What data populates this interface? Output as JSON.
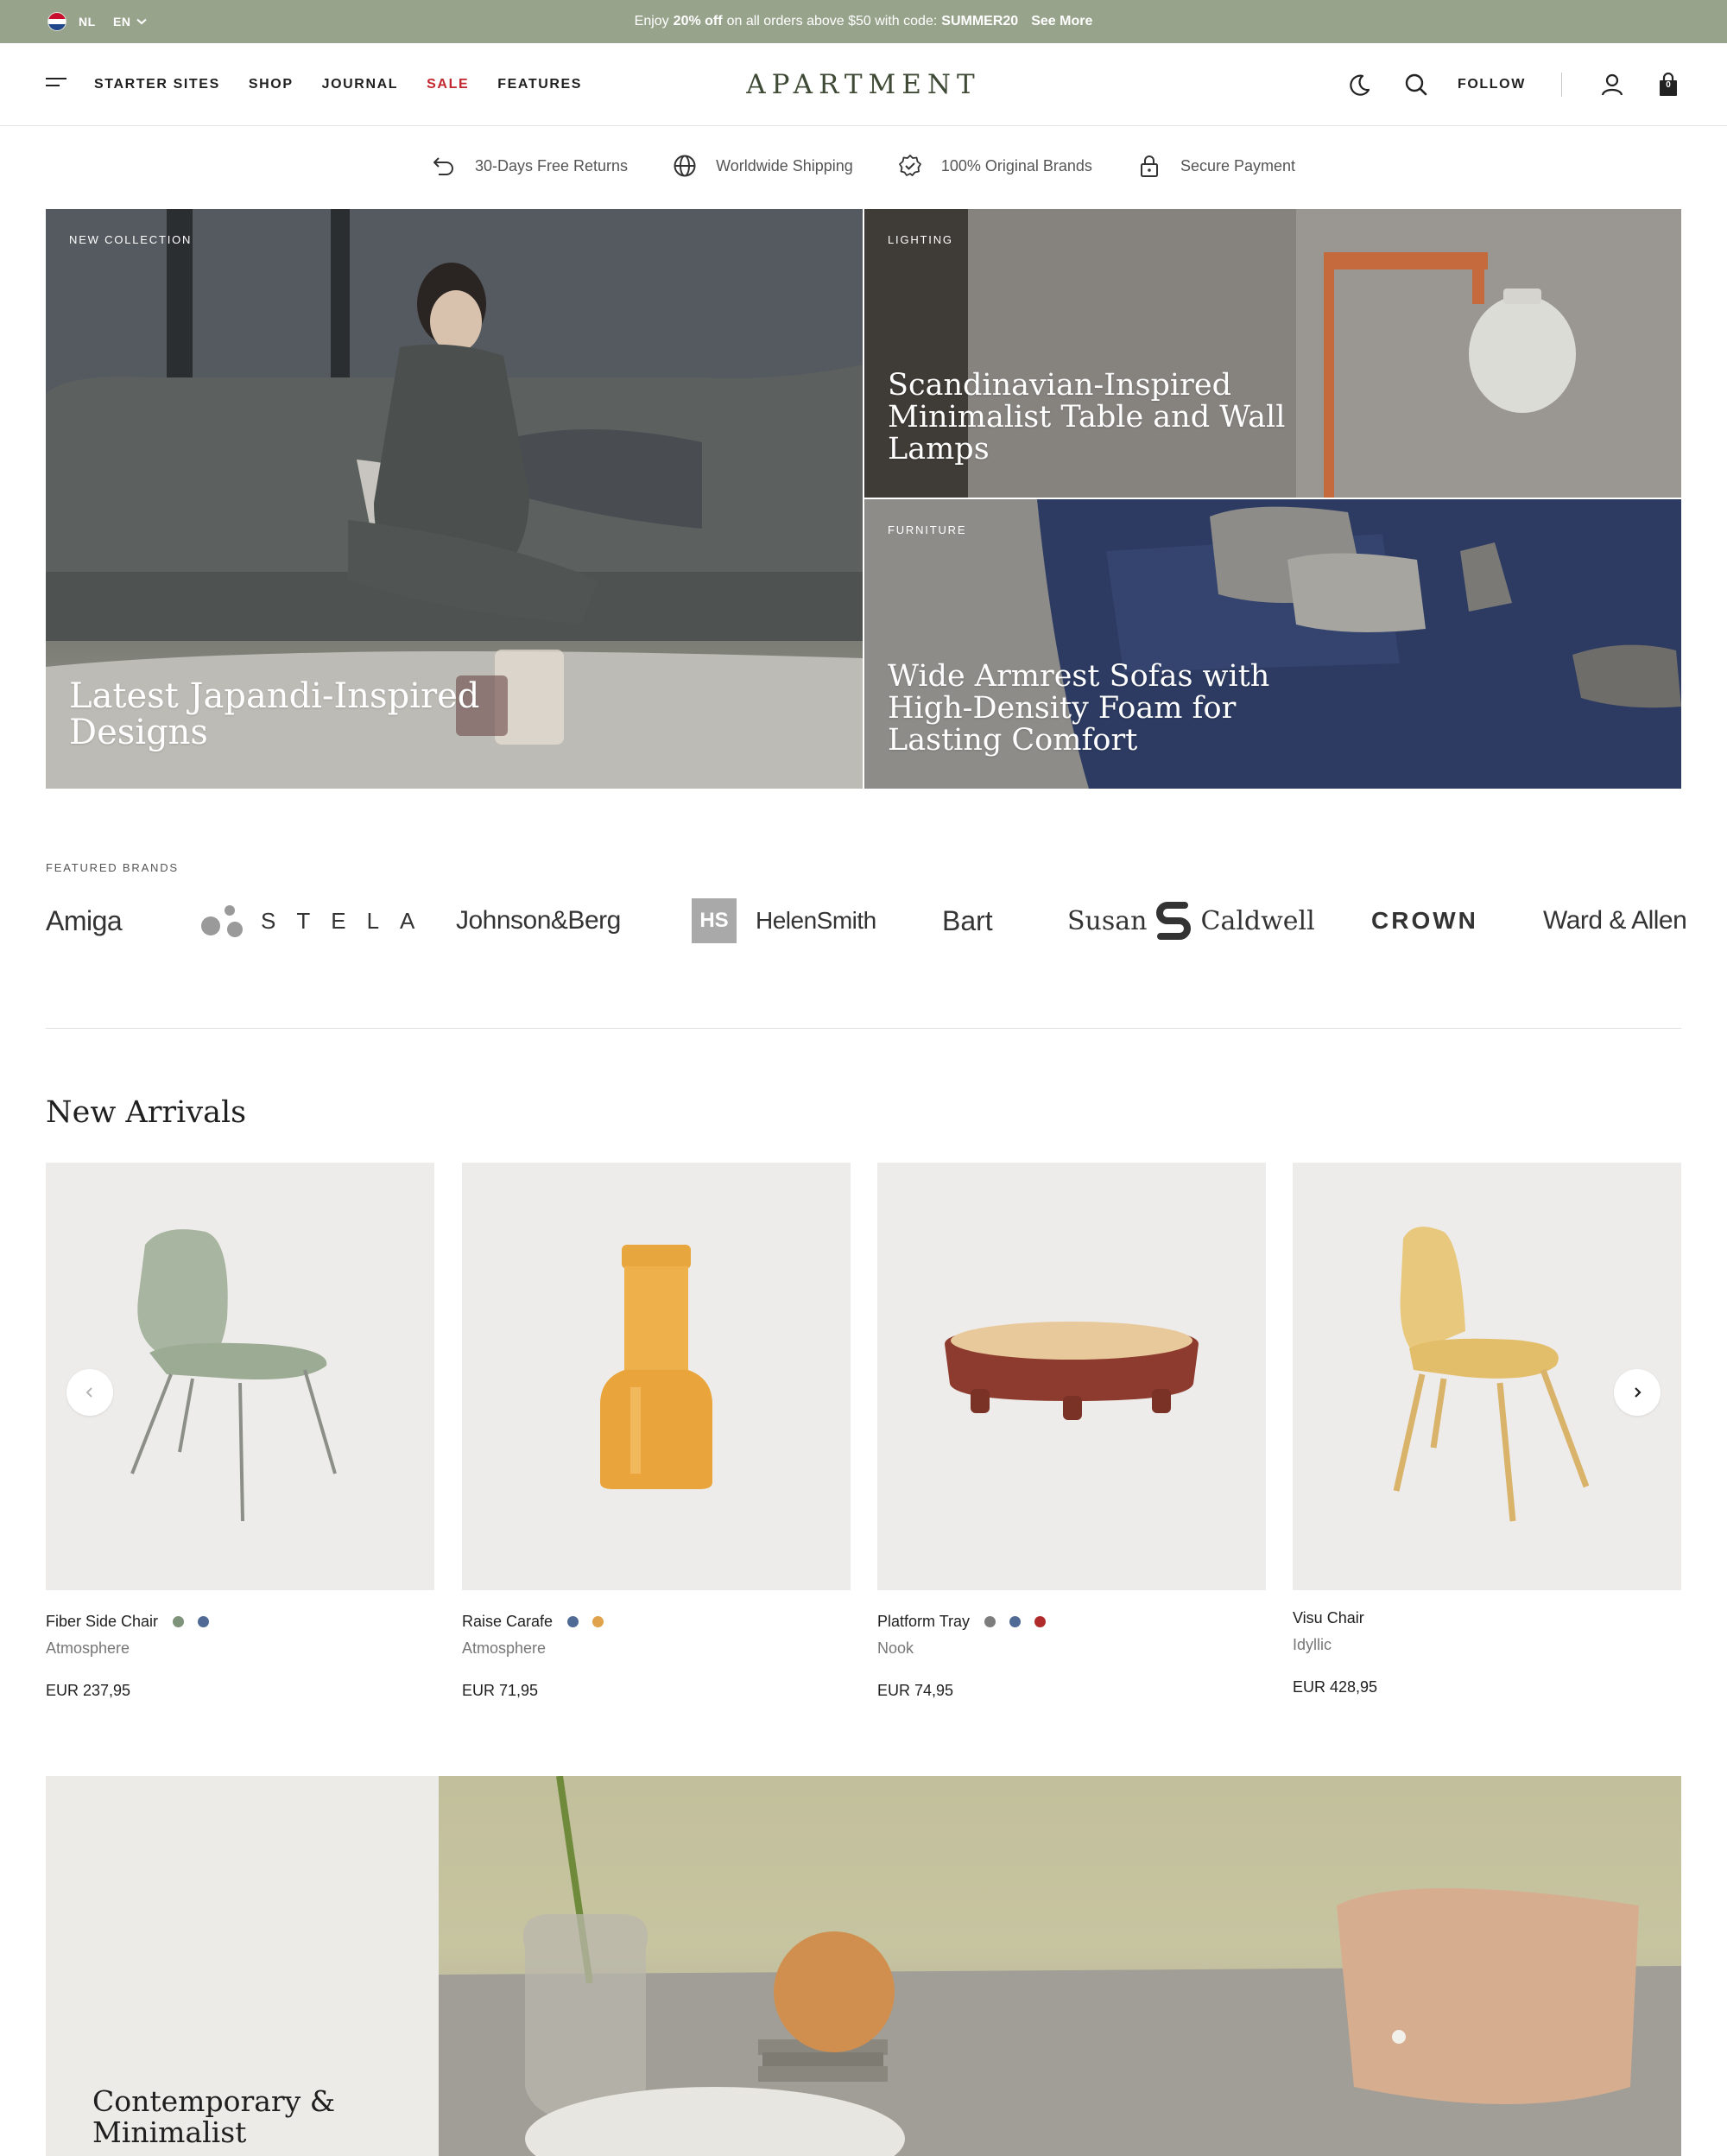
{
  "announcement": {
    "flag_colors": [
      "#c8102e",
      "#ffffff",
      "#21468b"
    ],
    "locale_label": "NL",
    "language_label": "EN",
    "promo_prefix": "Enjoy",
    "promo_highlight": "20% off",
    "promo_middle": "on all orders above $50 with code:",
    "promo_code": "SUMMER20",
    "see_more": "See More",
    "bg_color": "#98a38c"
  },
  "header": {
    "nav": [
      "Starter Sites",
      "Shop",
      "Journal",
      "Sale",
      "Features"
    ],
    "logo": "APARTMENT",
    "follow": "FOLLOW",
    "cart_count": "0",
    "sale_color": "#c2262e"
  },
  "usps": [
    {
      "icon": "return-icon",
      "label": "30-Days Free Returns"
    },
    {
      "icon": "globe-icon",
      "label": "Worldwide Shipping"
    },
    {
      "icon": "badge-check-icon",
      "label": "100% Original Brands"
    },
    {
      "icon": "lock-icon",
      "label": "Secure Payment"
    }
  ],
  "hero": {
    "main": {
      "eyebrow": "NEW COLLECTION",
      "headline_1": "Latest Japandi-Inspired",
      "headline_2": "Designs"
    },
    "lighting": {
      "eyebrow": "LIGHTING",
      "headline_1": "Scandinavian-Inspired",
      "headline_2": "Minimalist Table and Wall",
      "headline_3": "Lamps"
    },
    "furniture": {
      "eyebrow": "FURNITURE",
      "headline_1": "Wide Armrest Sofas with",
      "headline_2": "High-Density Foam for",
      "headline_3": "Lasting Comfort"
    }
  },
  "brands": {
    "label": "FEATURED BRANDS",
    "items": [
      "Amiga",
      "STELA",
      "Johnson&Berg",
      "HelenSmith",
      "Bart",
      "Susan",
      "Caldwell",
      "CROWN",
      "Ward & Allen"
    ],
    "helensmith_mark": "HS"
  },
  "new_arrivals": {
    "title": "New Arrivals",
    "products": [
      {
        "name": "Fiber Side Chair",
        "vendor": "Atmosphere",
        "price": "EUR 237,95",
        "swatches": [
          "#7f927a",
          "#4f6a95"
        ]
      },
      {
        "name": "Raise Carafe",
        "vendor": "Atmosphere",
        "price": "EUR 71,95",
        "swatches": [
          "#4f6a95",
          "#e0a24a"
        ]
      },
      {
        "name": "Platform Tray",
        "vendor": "Nook",
        "price": "EUR 74,95",
        "swatches": [
          "#7d7d7d",
          "#4f6a95",
          "#b02a2a"
        ]
      },
      {
        "name": "Visu Chair",
        "vendor": "Idyllic",
        "price": "EUR 428,95",
        "swatches": []
      }
    ]
  },
  "feature": {
    "headline_1": "Contemporary &",
    "headline_2": "Minimalist"
  }
}
